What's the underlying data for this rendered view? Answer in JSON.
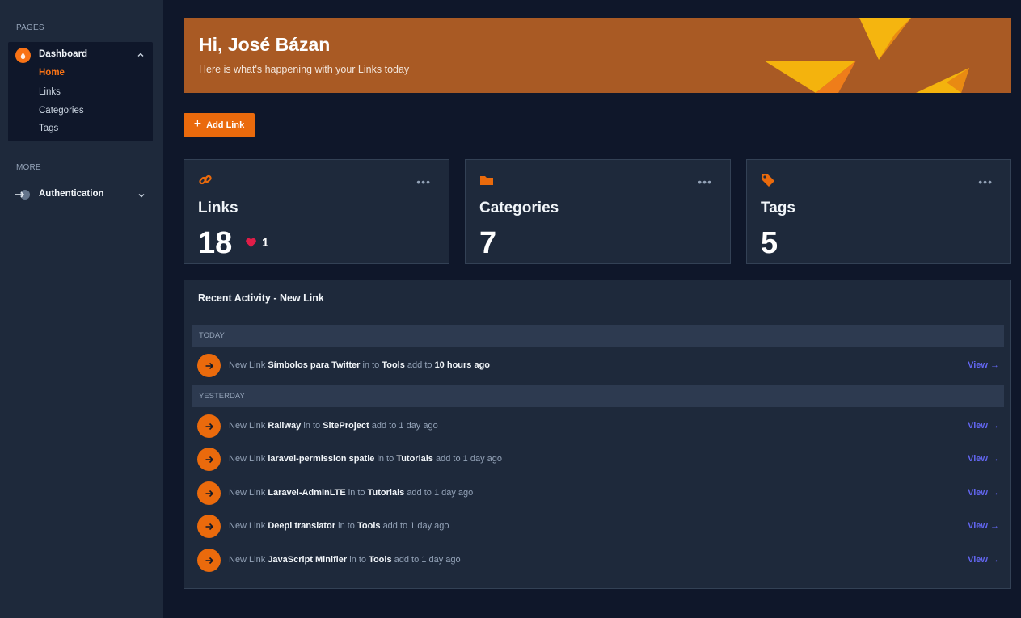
{
  "sidebar": {
    "pages_label": "PAGES",
    "more_label": "MORE",
    "dashboard": {
      "label": "Dashboard",
      "items": [
        {
          "label": "Home",
          "active": true
        },
        {
          "label": "Links",
          "active": false
        },
        {
          "label": "Categories",
          "active": false
        },
        {
          "label": "Tags",
          "active": false
        }
      ]
    },
    "authentication": {
      "label": "Authentication"
    }
  },
  "banner": {
    "title": "Hi, José Bázan",
    "subtitle": "Here is what's happening with your Links today"
  },
  "actions": {
    "add_link": "Add Link"
  },
  "stats": [
    {
      "title": "Links",
      "value": "18",
      "icon": "link-icon",
      "likes": "1"
    },
    {
      "title": "Categories",
      "value": "7",
      "icon": "folder-icon"
    },
    {
      "title": "Tags",
      "value": "5",
      "icon": "tag-icon"
    }
  ],
  "activity": {
    "title": "Recent Activity - New Link",
    "groups": [
      {
        "label": "TODAY",
        "rows": [
          {
            "prefix": "New Link",
            "name": "Símbolos para Twitter",
            "mid": "in to",
            "category": "Tools",
            "add": "add to",
            "time": "10 hours ago",
            "time_bold": true,
            "view": "View →"
          }
        ]
      },
      {
        "label": "YESTERDAY",
        "rows": [
          {
            "prefix": "New Link",
            "name": "Railway",
            "mid": "in to",
            "category": "SiteProject",
            "add": "add to",
            "time": "1 day ago",
            "view": "View →"
          },
          {
            "prefix": "New Link",
            "name": "laravel-permission spatie",
            "mid": "in to",
            "category": "Tutorials",
            "add": "add to",
            "time": "1 day ago",
            "view": "View →"
          },
          {
            "prefix": "New Link",
            "name": "Laravel-AdminLTE",
            "mid": "in to",
            "category": "Tutorials",
            "add": "add to",
            "time": "1 day ago",
            "view": "View →"
          },
          {
            "prefix": "New Link",
            "name": "Deepl translator",
            "mid": "in to",
            "category": "Tools",
            "add": "add to",
            "time": "1 day ago",
            "view": "View →"
          },
          {
            "prefix": "New Link",
            "name": "JavaScript Minifier",
            "mid": "in to",
            "category": "Tools",
            "add": "add to",
            "time": "1 day ago",
            "view": "View →"
          }
        ]
      }
    ]
  },
  "colors": {
    "accent": "#ea6a0c",
    "banner": "#a95a24",
    "link": "#6366f1",
    "heart": "#e11d48"
  }
}
